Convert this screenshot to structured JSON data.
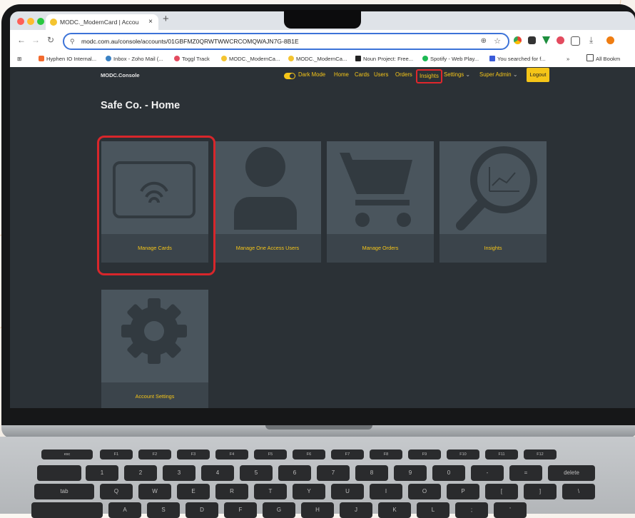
{
  "browser": {
    "tab_title": "MODC._ModernCard | Accou",
    "tab_close": "×",
    "new_tab": "+",
    "url": "modc.com.au/console/accounts/01GBFMZ0QRWTWWCRCOMQWAJN7G-8B1E",
    "bookmarks": [
      "Hyphen IO Internal...",
      "Inbox - Zoho Mail (...",
      "Toggl Track",
      "MODC._ModernCa...",
      "MODC._ModernCa...",
      "Noun Project: Free...",
      "Spotify - Web Play...",
      "You searched for f...",
      "»",
      "All Bookm"
    ]
  },
  "app": {
    "brand": "MODC.Console",
    "page_title": "Safe Co. - Home",
    "nav": {
      "dark_mode": "Dark Mode",
      "home": "Home",
      "cards": "Cards",
      "users": "Users",
      "orders": "Orders",
      "insights": "Insights",
      "settings": "Settings",
      "super_admin": "Super Admin",
      "logout": "Logout"
    },
    "tiles": [
      {
        "label": "Manage Cards",
        "icon": "contactless-card-icon"
      },
      {
        "label": "Manage One Access Users",
        "icon": "user-icon"
      },
      {
        "label": "Manage Orders",
        "icon": "shopping-cart-icon"
      },
      {
        "label": "Insights",
        "icon": "magnifier-chart-icon"
      },
      {
        "label": "Account Settings",
        "icon": "gear-icon"
      }
    ]
  },
  "keyboard": {
    "esc": "esc",
    "delete": "delete",
    "tab": "tab",
    "fn_row": [
      "F1",
      "F2",
      "F3",
      "F4",
      "F5",
      "F6",
      "F7",
      "F8",
      "F9",
      "F10",
      "F11",
      "F12"
    ],
    "number_row": [
      "1",
      "2",
      "3",
      "4",
      "5",
      "6",
      "7",
      "8",
      "9",
      "0",
      "-",
      "="
    ],
    "qwerty_row": [
      "Q",
      "W",
      "E",
      "R",
      "T",
      "Y",
      "U",
      "I",
      "O",
      "P",
      "[",
      "]",
      "\\"
    ],
    "home_row": [
      "A",
      "S",
      "D",
      "F",
      "G",
      "H",
      "J",
      "K",
      "L",
      ";",
      "'"
    ]
  },
  "colors": {
    "accent": "#f5c518",
    "page_bg": "#2b3136",
    "highlight": "#d8262b"
  }
}
